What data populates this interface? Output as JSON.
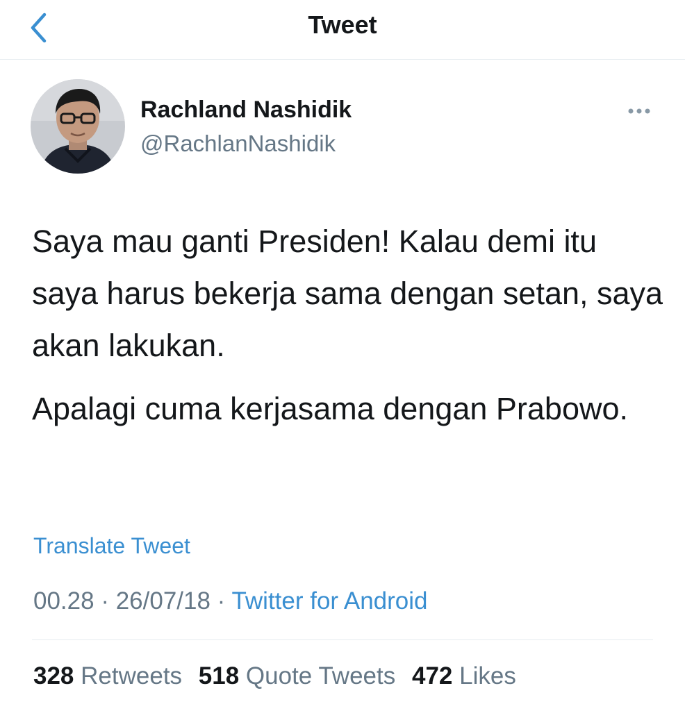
{
  "header": {
    "title": "Tweet",
    "back_icon": "chevron-left-icon",
    "accent_color": "#3a8fd1"
  },
  "author": {
    "name": "Rachland Nashidik",
    "handle": "@RachlanNashidik",
    "more_icon": "ellipsis-icon"
  },
  "tweet": {
    "paragraphs": [
      "Saya mau ganti Presiden! Kalau demi itu saya harus bekerja sama dengan setan, saya akan lakukan.",
      "Apalagi cuma kerjasama dengan Prabowo."
    ],
    "translate_label": "Translate Tweet"
  },
  "meta": {
    "time": "00.28",
    "separator": " · ",
    "date": "26/07/18",
    "source": "Twitter for Android"
  },
  "stats": {
    "retweets_count": "328",
    "retweets_label": "Retweets",
    "quotes_count": "518",
    "quotes_label": "Quote Tweets",
    "likes_count": "472",
    "likes_label": "Likes"
  }
}
